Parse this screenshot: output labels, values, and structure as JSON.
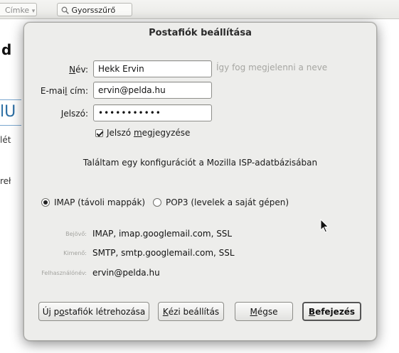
{
  "background": {
    "tag_chip": "Címke",
    "quick_filter": "Gyorsszűrő",
    "heading_fragment": "d",
    "blue_fragment": "lU",
    "text_fragment_1": "lét",
    "text_fragment_2": "reł"
  },
  "dialog": {
    "title": "Postafiók beállítása",
    "name": {
      "label_prefix": "",
      "label_access": "N",
      "label_rest": "év:",
      "value": "Hekk Ervin",
      "hint": "Így fog megjelenni a neve"
    },
    "email": {
      "label_prefix": "E-mai",
      "label_access": "l",
      "label_rest": " cím:",
      "value": "ervin@pelda.hu"
    },
    "password": {
      "label_prefix": "",
      "label_access": "J",
      "label_rest": "elszó:",
      "value": "•••••••••••"
    },
    "remember": {
      "prefix": "Jelszó ",
      "access": "m",
      "rest": "egjegyzése",
      "checked": true
    },
    "status": "Találtam egy konfigurációt a Mozilla ISP-adatbázisában",
    "protocol": {
      "imap_label": "IMAP (távoli mappák)",
      "pop3_label": "POP3 (levelek a saját gépen)",
      "selected": "IMAP"
    },
    "details": {
      "incoming_label": "Bejövő:",
      "incoming_value": "IMAP, imap.googlemail.com, SSL",
      "outgoing_label": "Kimenő:",
      "outgoing_value": "SMTP, smtp.googlemail.com, SSL",
      "username_label": "Felhasználónév:",
      "username_value": "ervin@pelda.hu"
    },
    "buttons": {
      "new_account": {
        "prefix": "Új p",
        "access": "o",
        "rest": "stafiók létrehozása"
      },
      "manual": {
        "prefix": "",
        "access": "K",
        "rest": "ézi beállítás"
      },
      "cancel": {
        "prefix": "",
        "access": "M",
        "rest": "égse"
      },
      "done": {
        "prefix": "",
        "access": "B",
        "rest": "efejezés"
      }
    }
  }
}
